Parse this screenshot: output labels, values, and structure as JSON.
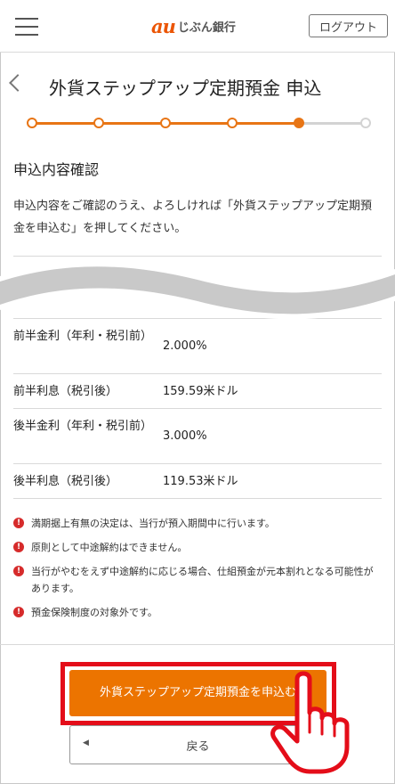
{
  "header": {
    "logo_au": "au",
    "logo_text": "じぶん銀行",
    "logout_label": "ログアウト"
  },
  "title": "外貨ステップアップ定期預金 申込",
  "stepper": {
    "total_steps": 6,
    "current_step": 5
  },
  "section_title": "申込内容確認",
  "intro": "申込内容をご確認のうえ、よろしければ「外貨ステップアップ定期預金を申込む」を押してください。",
  "table": {
    "rows": [
      {
        "label": "前半金利（年利・税引前）",
        "value": "2.000%"
      },
      {
        "label": "前半利息（税引後）",
        "value": "159.59米ドル"
      },
      {
        "label": "後半金利（年利・税引前）",
        "value": "3.000%"
      },
      {
        "label": "後半利息（税引後）",
        "value": "119.53米ドル"
      }
    ]
  },
  "notes": [
    "満期据上有無の決定は、当行が預入期間中に行います。",
    "原則として中途解約はできません。",
    "当行がやむをえず中途解約に応じる場合、仕組預金が元本割れとなる可能性があります。",
    "預金保険制度の対象外です。"
  ],
  "buttons": {
    "submit_label": "外貨ステップアップ定期預金を申込む",
    "back_label": "戻る"
  },
  "colors": {
    "brand": "#eb5505",
    "accent": "#ec7400",
    "highlight": "#e40d19",
    "note_icon": "#d62b2b"
  },
  "icons": {
    "menu": "hamburger-menu-icon",
    "back": "chevron-left-icon",
    "note": "exclamation-circle-icon",
    "pointer": "pointing-hand-icon"
  }
}
